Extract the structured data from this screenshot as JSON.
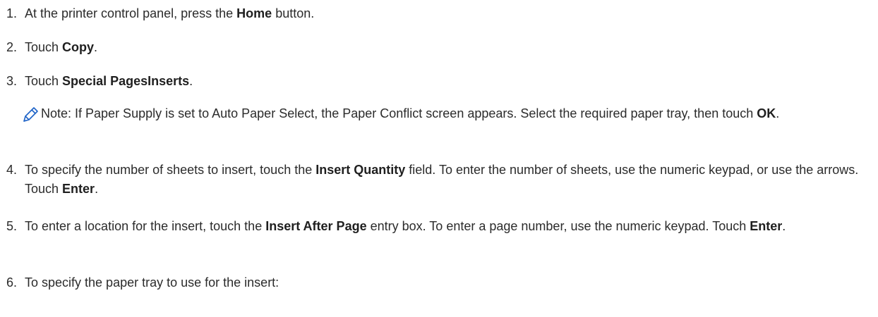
{
  "steps": [
    {
      "num": "1.",
      "t1": "At the printer control panel, press the ",
      "b1": "Home",
      "t2": " button."
    },
    {
      "num": "2.",
      "t1": "Touch ",
      "b1": "Copy",
      "t2": "."
    },
    {
      "num": "3.",
      "t1": "Touch ",
      "b1": "Special PagesInserts",
      "t2": "."
    },
    {
      "num": "4.",
      "t1": "To specify the number of sheets to insert, touch the ",
      "b1": "Insert Quantity",
      "t2": " field. To enter the number of sheets, use the numeric keypad, or use the arrows. Touch ",
      "b2": "Enter",
      "t3": "."
    },
    {
      "num": "5.",
      "t1": "To enter a location for the insert, touch the ",
      "b1": "Insert After Page",
      "t2": " entry box. To enter a page number, use the numeric keypad. Touch ",
      "b2": "Enter",
      "t3": "."
    },
    {
      "num": "6.",
      "t1": "To specify the paper tray to use for the insert:"
    }
  ],
  "note": {
    "icon": "pencil-icon",
    "text_before": "Note: If Paper Supply is set to Auto Paper Select, the Paper Conflict screen appears. Select the required paper tray, then touch ",
    "bold": "OK",
    "text_after": "."
  },
  "colors": {
    "text": "#2b2b2b",
    "note_icon": "#1e63c7"
  }
}
